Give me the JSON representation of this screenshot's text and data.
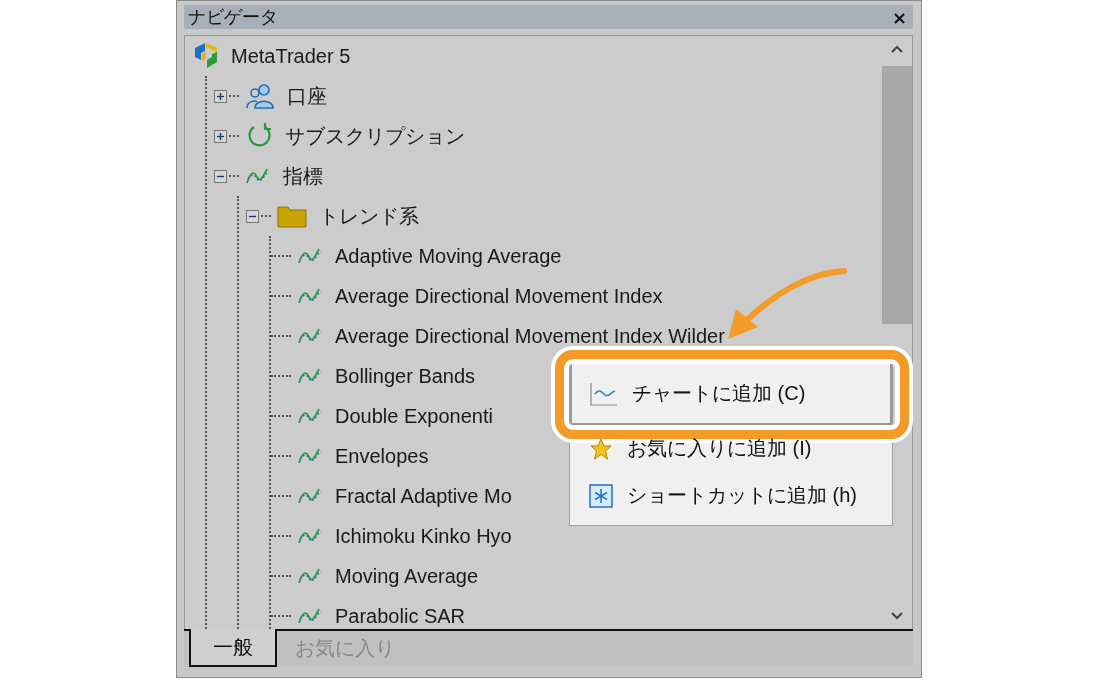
{
  "window": {
    "title": "ナビゲータ",
    "close": "×"
  },
  "tree": {
    "label": "MetaTrader 5",
    "kind": "app",
    "children": [
      {
        "label": "口座",
        "kind": "accounts",
        "expanded": false
      },
      {
        "label": "サブスクリプション",
        "kind": "subscription",
        "expanded": false
      },
      {
        "label": "指標",
        "kind": "indicator",
        "expanded": true,
        "children": [
          {
            "label": "トレンド系",
            "kind": "folder",
            "expanded": true,
            "children": [
              {
                "label": "Adaptive Moving Average",
                "kind": "indicator"
              },
              {
                "label": "Average Directional Movement Index",
                "kind": "indicator"
              },
              {
                "label": "Average Directional Movement Index Wilder",
                "kind": "indicator"
              },
              {
                "label": "Bollinger Bands",
                "kind": "indicator"
              },
              {
                "label": "Double Exponenti",
                "kind": "indicator"
              },
              {
                "label": "Envelopes",
                "kind": "indicator"
              },
              {
                "label": "Fractal Adaptive Mo",
                "kind": "indicator"
              },
              {
                "label": "Ichimoku Kinko Hyo",
                "kind": "indicator"
              },
              {
                "label": "Moving Average",
                "kind": "indicator"
              },
              {
                "label": "Parabolic SAR",
                "kind": "indicator"
              }
            ]
          }
        ]
      }
    ]
  },
  "tabs": [
    {
      "label": "一般",
      "selected": true
    },
    {
      "label": "お気に入り",
      "selected": false
    }
  ],
  "context_menu": {
    "items": [
      {
        "label": "チャートに追加 (C)",
        "kind": "chart",
        "selected": true
      },
      {
        "label": "お気に入りに追加 (I)",
        "kind": "favorite",
        "selected": false
      },
      {
        "label": "ショートカットに追加 (h)",
        "kind": "shortcut",
        "selected": false
      }
    ]
  }
}
